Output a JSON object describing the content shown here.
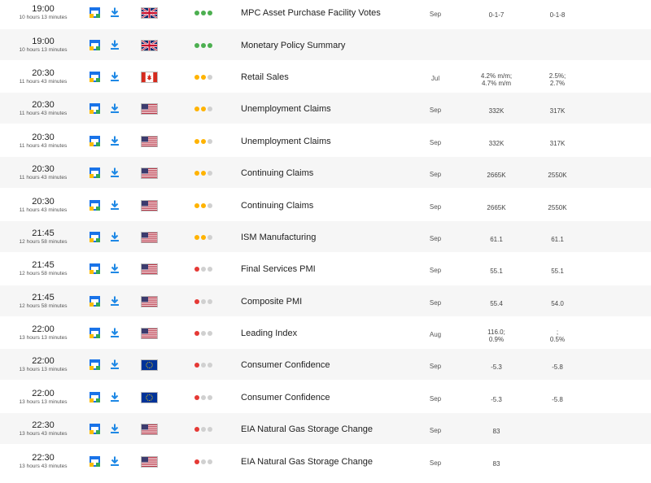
{
  "icons": {
    "calendar": "google-calendar-icon",
    "download": "download-icon"
  },
  "colors": {
    "impact_high": "#4caf50",
    "impact_medium": "#ffb300",
    "impact_low": "#e53935",
    "impact_off": "#d0d0d0",
    "calendar_blue": "#1a73e8",
    "download_blue": "#1e88e5"
  },
  "events": [
    {
      "time": "19:00",
      "relative": "10 hours 13 minutes",
      "country": "uk",
      "impact_color": "green",
      "impact_level": 3,
      "title": "MPC Asset Purchase Facility Votes",
      "period": "Sep",
      "actual": [
        "0-1-7"
      ],
      "consensus": [
        "0-1-8"
      ]
    },
    {
      "time": "19:00",
      "relative": "10 hours 13 minutes",
      "country": "uk",
      "impact_color": "green",
      "impact_level": 3,
      "title": "Monetary Policy Summary",
      "period": "",
      "actual": [],
      "consensus": []
    },
    {
      "time": "20:30",
      "relative": "11 hours 43 minutes",
      "country": "ca",
      "impact_color": "orange",
      "impact_level": 2,
      "title": "Retail Sales",
      "period": "Jul",
      "actual": [
        "4.2% m/m;",
        "4.7% m/m"
      ],
      "consensus": [
        "2.5%;",
        "2.7%"
      ]
    },
    {
      "time": "20:30",
      "relative": "11 hours 43 minutes",
      "country": "us",
      "impact_color": "orange",
      "impact_level": 2,
      "title": "Unemployment Claims",
      "period": "Sep",
      "actual": [
        "332K"
      ],
      "consensus": [
        "317K"
      ]
    },
    {
      "time": "20:30",
      "relative": "11 hours 43 minutes",
      "country": "us",
      "impact_color": "orange",
      "impact_level": 2,
      "title": "Unemployment Claims",
      "period": "Sep",
      "actual": [
        "332K"
      ],
      "consensus": [
        "317K"
      ]
    },
    {
      "time": "20:30",
      "relative": "11 hours 43 minutes",
      "country": "us",
      "impact_color": "orange",
      "impact_level": 2,
      "title": "Continuing Claims",
      "period": "Sep",
      "actual": [
        "2665K"
      ],
      "consensus": [
        "2550K"
      ]
    },
    {
      "time": "20:30",
      "relative": "11 hours 43 minutes",
      "country": "us",
      "impact_color": "orange",
      "impact_level": 2,
      "title": "Continuing Claims",
      "period": "Sep",
      "actual": [
        "2665K"
      ],
      "consensus": [
        "2550K"
      ]
    },
    {
      "time": "21:45",
      "relative": "12 hours 58 minutes",
      "country": "us",
      "impact_color": "orange",
      "impact_level": 2,
      "title": "ISM Manufacturing",
      "period": "Sep",
      "actual": [
        "61.1"
      ],
      "consensus": [
        "61.1"
      ]
    },
    {
      "time": "21:45",
      "relative": "12 hours 58 minutes",
      "country": "us",
      "impact_color": "red",
      "impact_level": 1,
      "title": "Final Services PMI",
      "period": "Sep",
      "actual": [
        "55.1"
      ],
      "consensus": [
        "55.1"
      ]
    },
    {
      "time": "21:45",
      "relative": "12 hours 58 minutes",
      "country": "us",
      "impact_color": "red",
      "impact_level": 1,
      "title": "Composite PMI",
      "period": "Sep",
      "actual": [
        "55.4"
      ],
      "consensus": [
        "54.0"
      ]
    },
    {
      "time": "22:00",
      "relative": "13 hours 13 minutes",
      "country": "us",
      "impact_color": "red",
      "impact_level": 1,
      "title": "Leading Index",
      "period": "Aug",
      "actual": [
        "116.0;",
        "0.9%"
      ],
      "consensus": [
        ";",
        "0.5%"
      ]
    },
    {
      "time": "22:00",
      "relative": "13 hours 13 minutes",
      "country": "eu",
      "impact_color": "red",
      "impact_level": 1,
      "title": "Consumer Confidence",
      "period": "Sep",
      "actual": [
        "-5.3"
      ],
      "consensus": [
        "-5.8"
      ]
    },
    {
      "time": "22:00",
      "relative": "13 hours 13 minutes",
      "country": "eu",
      "impact_color": "red",
      "impact_level": 1,
      "title": "Consumer Confidence",
      "period": "Sep",
      "actual": [
        "-5.3"
      ],
      "consensus": [
        "-5.8"
      ]
    },
    {
      "time": "22:30",
      "relative": "13 hours 43 minutes",
      "country": "us",
      "impact_color": "red",
      "impact_level": 1,
      "title": "EIA Natural Gas Storage Change",
      "period": "Sep",
      "actual": [
        "83"
      ],
      "consensus": []
    },
    {
      "time": "22:30",
      "relative": "13 hours 43 minutes",
      "country": "us",
      "impact_color": "red",
      "impact_level": 1,
      "title": "EIA Natural Gas Storage Change",
      "period": "Sep",
      "actual": [
        "83"
      ],
      "consensus": []
    }
  ]
}
